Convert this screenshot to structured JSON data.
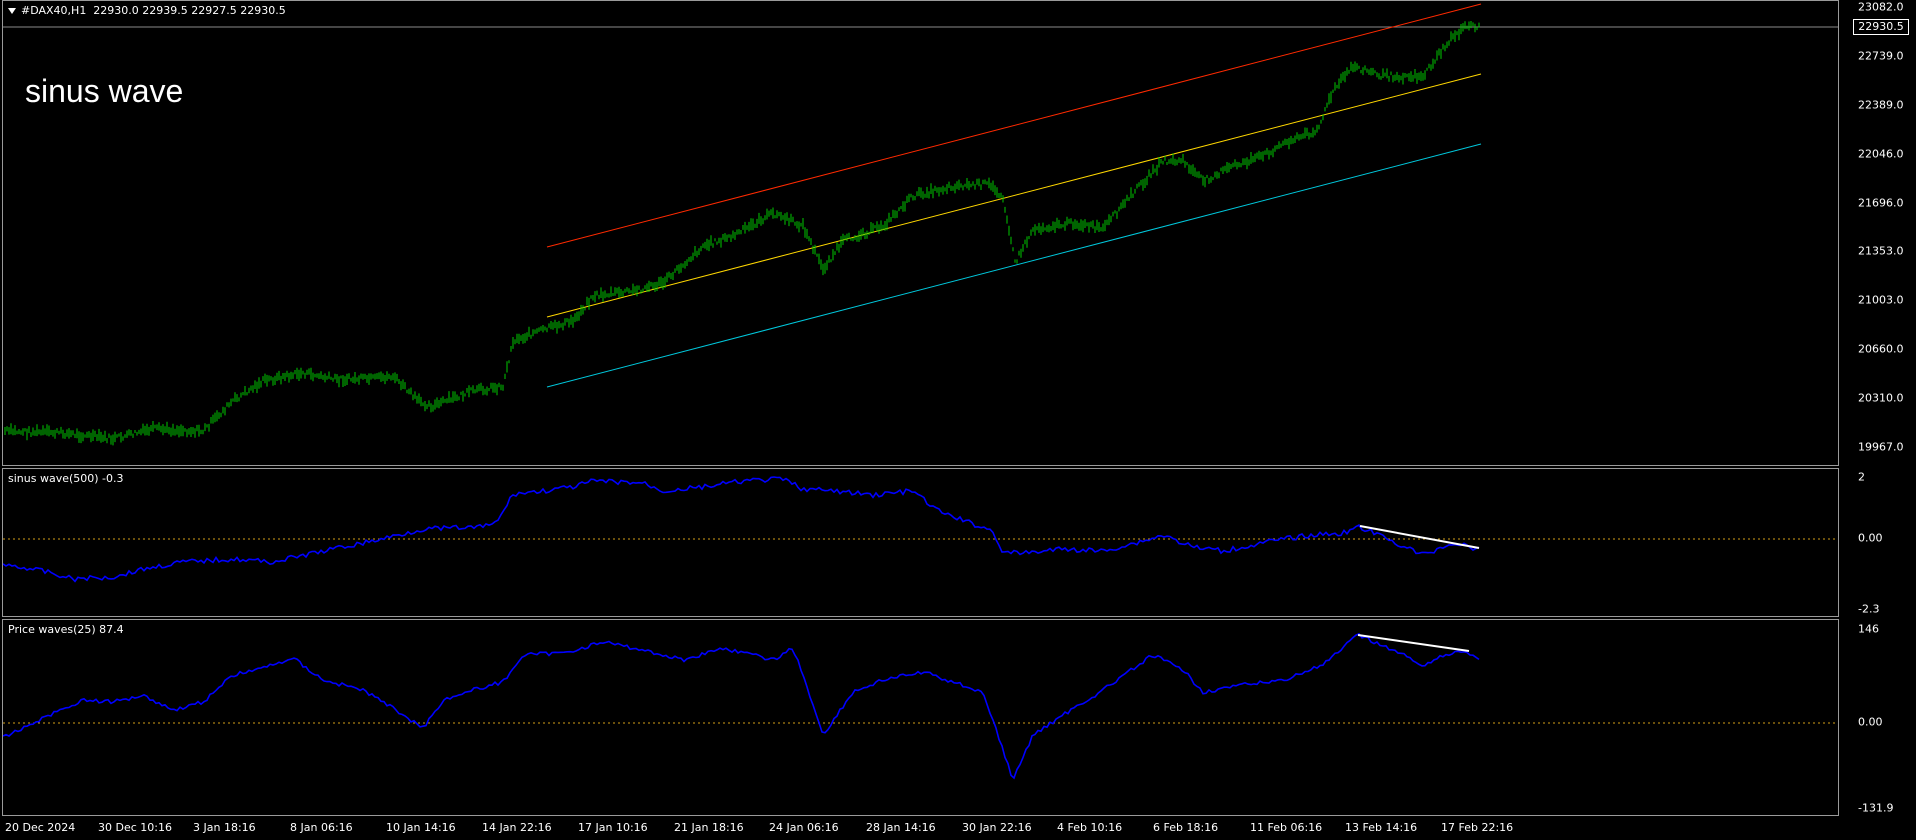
{
  "main": {
    "header": "#DAX40,H1  22930.0 22939.5 22927.5 22930.5",
    "overlay_label": "sinus wave",
    "price_ticks": [
      "23082.0",
      "22739.0",
      "22389.0",
      "22046.0",
      "21696.0",
      "21353.0",
      "21003.0",
      "20660.0",
      "20310.0",
      "19967.0"
    ],
    "current_price": "22930.5",
    "colors": {
      "candles": "#00c800",
      "upper_channel": "#ff2a00",
      "mid_channel": "#ffd700",
      "lower_channel": "#00c8dc"
    }
  },
  "sinus": {
    "header": "sinus wave(500) -0.3",
    "ticks": [
      "2",
      "0.00",
      "-2.3"
    ],
    "colors": {
      "line": "#0000ff",
      "zero": "#d4a017",
      "divergence": "#ffffff"
    }
  },
  "price_waves": {
    "header": "Price waves(25) 87.4",
    "ticks": [
      "146",
      "0.00",
      "-131.9"
    ],
    "colors": {
      "line": "#0000ff",
      "zero": "#d4a017",
      "divergence": "#ffffff"
    }
  },
  "time_axis": [
    "20 Dec 2024",
    "30 Dec 10:16",
    "3 Jan 18:16",
    "8 Jan 06:16",
    "10 Jan 14:16",
    "14 Jan 22:16",
    "17 Jan 10:16",
    "21 Jan 18:16",
    "24 Jan 06:16",
    "28 Jan 14:16",
    "30 Jan 22:16",
    "4 Feb 10:16",
    "6 Feb 18:16",
    "11 Feb 06:16",
    "13 Feb 14:16",
    "17 Feb 22:16"
  ]
}
